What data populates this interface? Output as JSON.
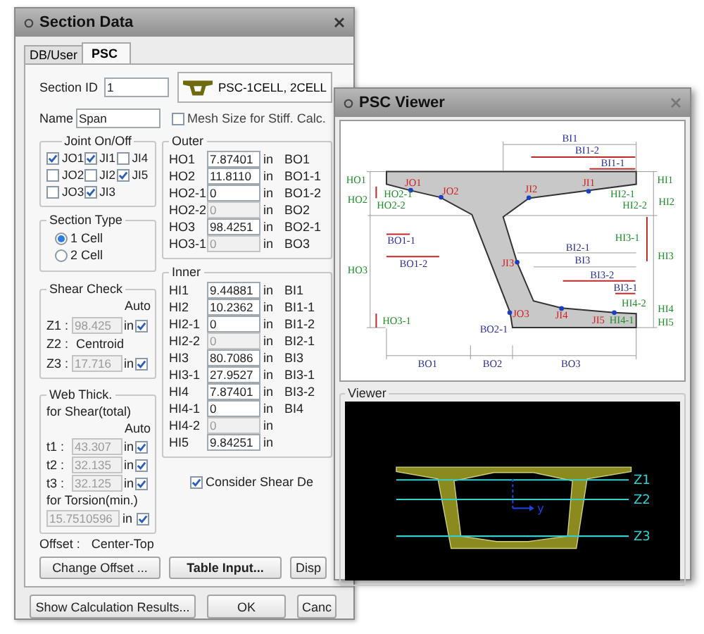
{
  "dialog": {
    "title": "Section Data",
    "tabs": [
      {
        "label": "DB/User",
        "selected": false
      },
      {
        "label": "PSC",
        "selected": true
      }
    ],
    "section_id": {
      "label": "Section ID",
      "value": "1"
    },
    "section_shape": {
      "value": "PSC-1CELL, 2CELL"
    },
    "name": {
      "label": "Name",
      "value": "Span"
    },
    "mesh_size": {
      "label": "Mesh Size for Stiff. Calc.",
      "checked": false
    },
    "joint_group": {
      "title": "Joint On/Off",
      "joints": [
        {
          "label": "JO1",
          "checked": true
        },
        {
          "label": "JI1",
          "checked": true
        },
        {
          "label": "JI4",
          "checked": false
        },
        {
          "label": "JO2",
          "checked": false
        },
        {
          "label": "JI2",
          "checked": false
        },
        {
          "label": "JI5",
          "checked": true
        },
        {
          "label": "JO3",
          "checked": false
        },
        {
          "label": "JI3",
          "checked": true
        }
      ]
    },
    "section_type": {
      "title": "Section Type",
      "options": [
        {
          "label": "1 Cell",
          "selected": true
        },
        {
          "label": "2 Cell",
          "selected": false
        }
      ]
    },
    "outer": {
      "title": "Outer",
      "rows": [
        {
          "label": "HO1",
          "value": "7.87401",
          "unit": "in",
          "disabled": false,
          "right_label": "BO1"
        },
        {
          "label": "HO2",
          "value": "11.8110",
          "unit": "in",
          "disabled": false,
          "right_label": "BO1-1"
        },
        {
          "label": "HO2-1",
          "value": "0",
          "unit": "in",
          "disabled": false,
          "right_label": "BO1-2"
        },
        {
          "label": "HO2-2",
          "value": "0",
          "unit": "in",
          "disabled": true,
          "right_label": "BO2"
        },
        {
          "label": "HO3",
          "value": "98.4251",
          "unit": "in",
          "disabled": false,
          "right_label": "BO2-1"
        },
        {
          "label": "HO3-1",
          "value": "0",
          "unit": "in",
          "disabled": true,
          "right_label": "BO3"
        }
      ]
    },
    "inner": {
      "title": "Inner",
      "rows": [
        {
          "label": "HI1",
          "value": "9.44881",
          "unit": "in",
          "disabled": false,
          "right_label": "BI1"
        },
        {
          "label": "HI2",
          "value": "10.2362",
          "unit": "in",
          "disabled": false,
          "right_label": "BI1-1"
        },
        {
          "label": "HI2-1",
          "value": "0",
          "unit": "in",
          "disabled": false,
          "right_label": "BI1-2"
        },
        {
          "label": "HI2-2",
          "value": "0",
          "unit": "in",
          "disabled": true,
          "right_label": "BI2-1"
        },
        {
          "label": "HI3",
          "value": "80.7086",
          "unit": "in",
          "disabled": false,
          "right_label": "BI3"
        },
        {
          "label": "HI3-1",
          "value": "27.9527",
          "unit": "in",
          "disabled": false,
          "right_label": "BI3-1"
        },
        {
          "label": "HI4",
          "value": "7.87401",
          "unit": "in",
          "disabled": false,
          "right_label": "BI3-2"
        },
        {
          "label": "HI4-1",
          "value": "0",
          "unit": "in",
          "disabled": false,
          "right_label": "BI4"
        },
        {
          "label": "HI4-2",
          "value": "0",
          "unit": "in",
          "disabled": true
        },
        {
          "label": "HI5",
          "value": "9.84251",
          "unit": "in",
          "disabled": false
        }
      ]
    },
    "shear_check": {
      "title": "Shear Check",
      "auto_label": "Auto",
      "rows": [
        {
          "kind": "field",
          "label": "Z1 :",
          "value": "98.425",
          "unit": "in",
          "disabled": true,
          "auto": true
        },
        {
          "kind": "text",
          "label": "Z2 :",
          "value": "Centroid"
        },
        {
          "kind": "field",
          "label": "Z3 :",
          "value": "17.716",
          "unit": "in",
          "disabled": true,
          "auto": true
        }
      ]
    },
    "web_thick": {
      "title": "Web Thick.",
      "shear_label": "for Shear(total)",
      "auto_label": "Auto",
      "rows": [
        {
          "label": "t1 :",
          "value": "43.307",
          "unit": "in",
          "disabled": true,
          "auto": true
        },
        {
          "label": "t2 :",
          "value": "32.135",
          "unit": "in",
          "disabled": true,
          "auto": true
        },
        {
          "label": "t3 :",
          "value": "32.125",
          "unit": "in",
          "disabled": true,
          "auto": true
        }
      ],
      "torsion_label": "for Torsion(min.)",
      "torsion": {
        "value": "15.7510596",
        "unit": "in",
        "disabled": true,
        "auto": true
      }
    },
    "consider_shear": {
      "label": "Consider Shear De",
      "checked": true
    },
    "offset": {
      "label": "Offset :",
      "value": "Center-Top"
    },
    "buttons": [
      {
        "label": "Change Offset ...",
        "bold": false
      },
      {
        "label": "Table Input...",
        "bold": true
      },
      {
        "label": "Disp",
        "bold": false
      }
    ],
    "footer_buttons": [
      "Show Calculation Results...",
      "OK",
      "Canc"
    ]
  },
  "viewer": {
    "title": "PSC Viewer",
    "drawing": {
      "labels": [
        {
          "text": "BI1",
          "kind": "width"
        },
        {
          "text": "BI1-2",
          "kind": "width"
        },
        {
          "text": "BI1-1",
          "kind": "width"
        },
        {
          "text": "HO1",
          "kind": "height"
        },
        {
          "text": "JO1",
          "kind": "joint"
        },
        {
          "text": "JO2",
          "kind": "joint"
        },
        {
          "text": "JI2",
          "kind": "joint"
        },
        {
          "text": "JI1",
          "kind": "joint"
        },
        {
          "text": "HI1",
          "kind": "height"
        },
        {
          "text": "HO2",
          "kind": "height"
        },
        {
          "text": "HO2-1",
          "kind": "height"
        },
        {
          "text": "HI2-1",
          "kind": "height"
        },
        {
          "text": "HI2",
          "kind": "height"
        },
        {
          "text": "HO2-2",
          "kind": "height"
        },
        {
          "text": "HI2-2",
          "kind": "height"
        },
        {
          "text": "BO1-1",
          "kind": "width"
        },
        {
          "text": "HI3-1",
          "kind": "height"
        },
        {
          "text": "BI2-1",
          "kind": "width"
        },
        {
          "text": "HI3",
          "kind": "height"
        },
        {
          "text": "BO1-2",
          "kind": "width"
        },
        {
          "text": "JI3",
          "kind": "joint"
        },
        {
          "text": "BI3",
          "kind": "width"
        },
        {
          "text": "HO3",
          "kind": "height"
        },
        {
          "text": "BI3-2",
          "kind": "width"
        },
        {
          "text": "BI3-1",
          "kind": "width"
        },
        {
          "text": "HI4-2",
          "kind": "height"
        },
        {
          "text": "HI4",
          "kind": "height"
        },
        {
          "text": "JO3",
          "kind": "joint"
        },
        {
          "text": "JI4",
          "kind": "joint"
        },
        {
          "text": "HO3-1",
          "kind": "height"
        },
        {
          "text": "JI5",
          "kind": "joint"
        },
        {
          "text": "HI4-1",
          "kind": "height"
        },
        {
          "text": "HI5",
          "kind": "height"
        },
        {
          "text": "BO2-1",
          "kind": "width"
        },
        {
          "text": "BO1",
          "kind": "width"
        },
        {
          "text": "BO2",
          "kind": "width"
        },
        {
          "text": "BO3",
          "kind": "width"
        }
      ]
    },
    "canvas": {
      "title": "Viewer",
      "axis_label": "y",
      "levels": [
        "Z1",
        "Z2",
        "Z3"
      ]
    }
  }
}
